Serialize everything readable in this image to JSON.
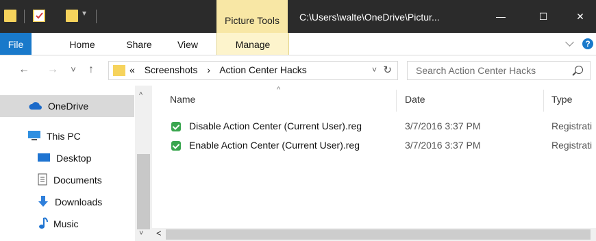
{
  "titlebar": {
    "context_tab": "Picture Tools",
    "title": "C:\\Users\\walte\\OneDrive\\Pictur...",
    "minimize_glyph": "—",
    "maximize_glyph": "☐",
    "close_glyph": "✕"
  },
  "ribbon": {
    "tabs": [
      "File",
      "Home",
      "Share",
      "View",
      "Manage"
    ],
    "help_glyph": "?"
  },
  "address": {
    "back_glyph": "←",
    "forward_glyph": "→",
    "recent_glyph": "˅",
    "up_glyph": "↑",
    "overflow": "«",
    "crumbs": [
      "Screenshots",
      "›",
      "Action Center Hacks"
    ],
    "dropdown_glyph": "˅",
    "refresh_glyph": "↻",
    "search_placeholder": "Search Action Center Hacks"
  },
  "nav": {
    "items": [
      "OneDrive",
      "This PC",
      "Desktop",
      "Documents",
      "Downloads",
      "Music"
    ],
    "up_glyph": "^",
    "down_glyph": "˅"
  },
  "files": {
    "headers": {
      "name": "Name",
      "date": "Date",
      "type": "Type"
    },
    "sort_glyph": "^",
    "rows": [
      {
        "name": "Disable Action Center (Current User).reg",
        "date": "3/7/2016 3:37 PM",
        "type": "Registrati"
      },
      {
        "name": "Enable Action Center (Current User).reg",
        "date": "3/7/2016 3:37 PM",
        "type": "Registrati"
      }
    ],
    "hscroll_left": "<"
  },
  "colors": {
    "accent": "#1979ca",
    "title_bg": "#2b2b2b",
    "context_tab": "#f8e7a5",
    "folder": "#f6d35c"
  }
}
